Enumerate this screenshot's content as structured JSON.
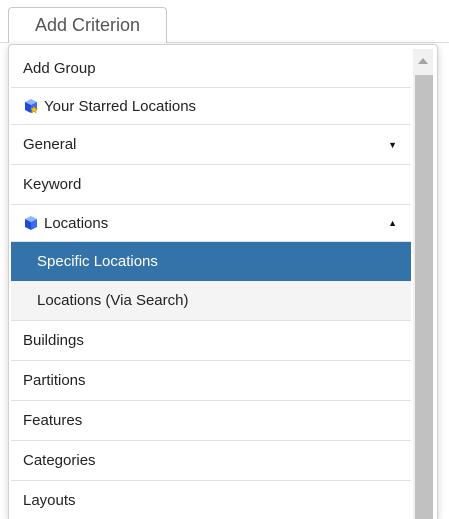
{
  "button": {
    "label": "Add Criterion"
  },
  "menu": {
    "items": [
      {
        "label": "Add Group"
      },
      {
        "label": "Your Starred Locations",
        "icon": "starred-cube-icon"
      },
      {
        "label": "General",
        "caret": "▼"
      },
      {
        "label": "Keyword"
      },
      {
        "label": "Locations",
        "icon": "cube-icon",
        "caret": "▲"
      },
      {
        "label": "Specific Locations",
        "selected": true
      },
      {
        "label": "Locations (Via Search)"
      },
      {
        "label": "Buildings"
      },
      {
        "label": "Partitions"
      },
      {
        "label": "Features"
      },
      {
        "label": "Categories"
      },
      {
        "label": "Layouts"
      }
    ]
  },
  "colors": {
    "selected_bg": "#3473a9",
    "selected_text": "#ffffff",
    "sub_bg": "#f4f4f4",
    "scroll_thumb": "#c1c1c1"
  }
}
